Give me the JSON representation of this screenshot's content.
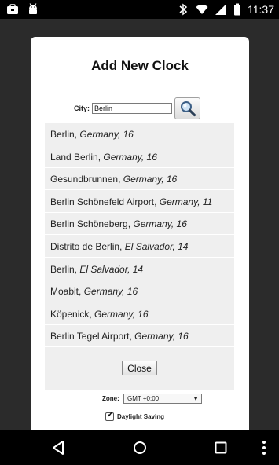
{
  "status_bar": {
    "time": "11:37",
    "left_icons": [
      "briefcase-icon",
      "android-icon"
    ],
    "right_icons": [
      "bluetooth-icon",
      "wifi-icon",
      "signal-icon",
      "battery-icon"
    ]
  },
  "dialog": {
    "title": "Add New Clock",
    "city_label": "City:",
    "city_value": "Berlin",
    "search_icon": "magnifier-icon",
    "results": [
      {
        "name": "Berlin, ",
        "detail": "Germany, 16"
      },
      {
        "name": "Land Berlin, ",
        "detail": "Germany, 16"
      },
      {
        "name": "Gesundbrunnen, ",
        "detail": "Germany, 16"
      },
      {
        "name": "Berlin Schönefeld Airport, ",
        "detail": "Germany, 11"
      },
      {
        "name": "Berlin Schöneberg, ",
        "detail": "Germany, 16"
      },
      {
        "name": "Distrito de Berlin, ",
        "detail": "El Salvador, 14"
      },
      {
        "name": "Berlin, ",
        "detail": "El Salvador, 14"
      },
      {
        "name": "Moabit, ",
        "detail": "Germany, 16"
      },
      {
        "name": "Köpenick, ",
        "detail": "Germany, 16"
      },
      {
        "name": "Berlin Tegel Airport, ",
        "detail": "Germany, 16"
      }
    ],
    "close_label": "Close",
    "zone_label": "Zone:",
    "zone_value": "GMT +0:00",
    "dst_label": "Daylight Saving",
    "dst_checked": true
  },
  "nav_bar": {
    "icons": [
      "back-icon",
      "home-icon",
      "recents-icon",
      "overflow-menu-icon"
    ]
  }
}
